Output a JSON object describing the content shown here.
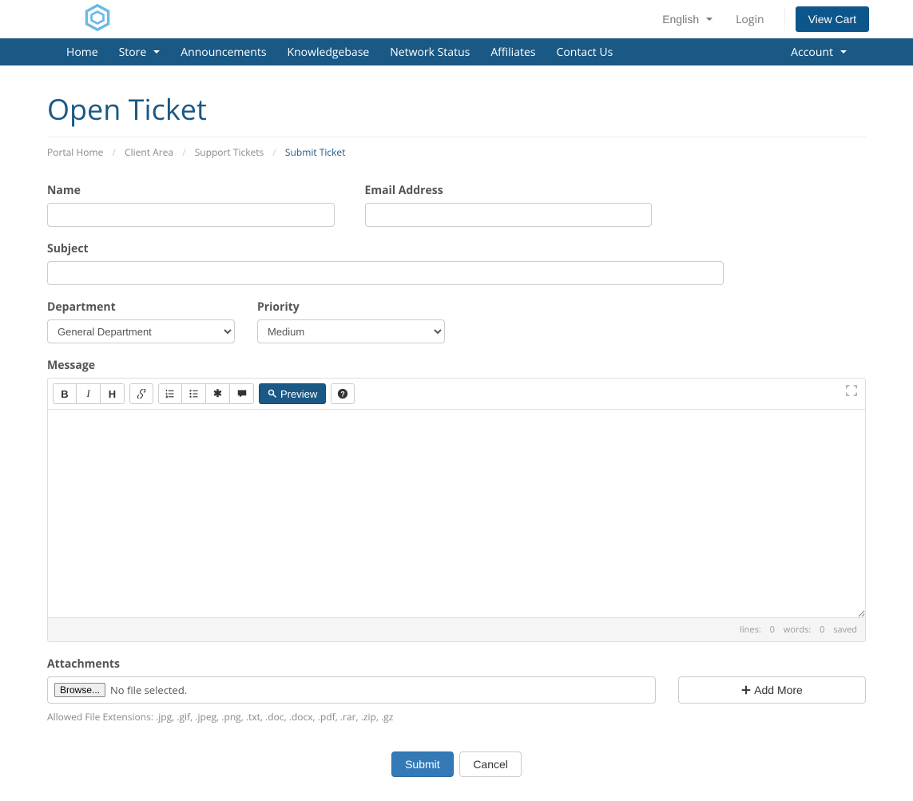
{
  "topbar": {
    "language": "English",
    "login": "Login",
    "view_cart": "View Cart"
  },
  "nav": {
    "home": "Home",
    "store": "Store",
    "announcements": "Announcements",
    "knowledgebase": "Knowledgebase",
    "network_status": "Network Status",
    "affiliates": "Affiliates",
    "contact": "Contact Us",
    "account": "Account"
  },
  "page": {
    "title": "Open Ticket"
  },
  "breadcrumb": {
    "portal_home": "Portal Home",
    "client_area": "Client Area",
    "support_tickets": "Support Tickets",
    "submit_ticket": "Submit Ticket"
  },
  "form": {
    "name_label": "Name",
    "name_value": "",
    "email_label": "Email Address",
    "email_value": "",
    "subject_label": "Subject",
    "subject_value": "",
    "department_label": "Department",
    "department_value": "General Department",
    "priority_label": "Priority",
    "priority_value": "Medium",
    "message_label": "Message",
    "message_value": ""
  },
  "editor": {
    "preview": "Preview",
    "lines_label": "lines:",
    "lines_value": "0",
    "words_label": "words:",
    "words_value": "0",
    "saved": "saved"
  },
  "attachments": {
    "label": "Attachments",
    "browse": "Browse...",
    "no_file": "No file selected.",
    "add_more": "Add More",
    "allowed": "Allowed File Extensions: .jpg, .gif, .jpeg, .png, .txt, .doc, .docx, .pdf, .rar, .zip, .gz"
  },
  "actions": {
    "submit": "Submit",
    "cancel": "Cancel"
  }
}
